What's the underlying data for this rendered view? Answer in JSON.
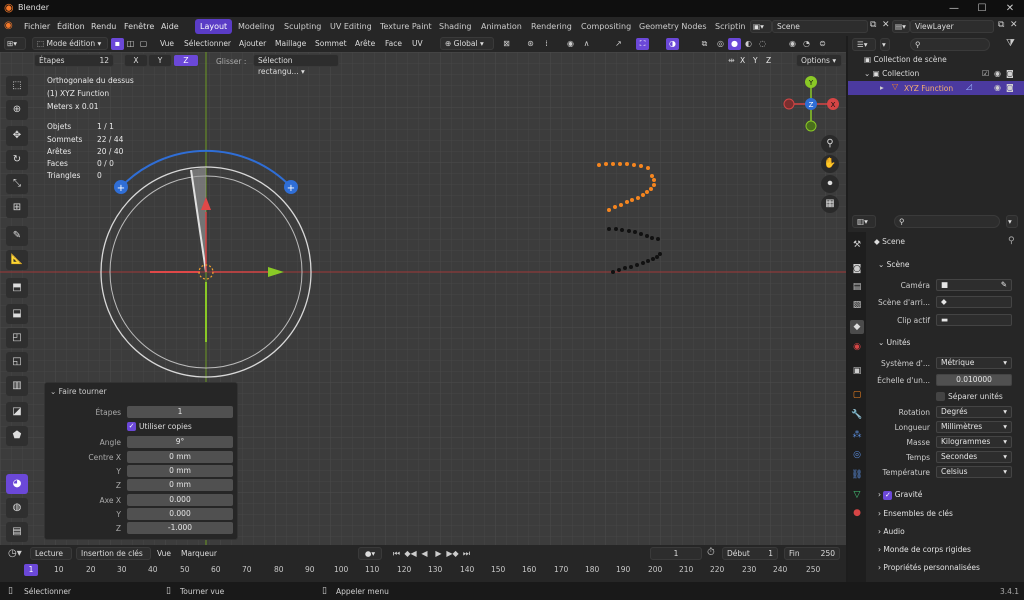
{
  "window": {
    "title": "Blender"
  },
  "menu": {
    "items": [
      "Fichier",
      "Édition",
      "Rendu",
      "Fenêtre",
      "Aide"
    ]
  },
  "workspaces": [
    {
      "label": "Layout",
      "active": true
    },
    {
      "label": "Modeling"
    },
    {
      "label": "Sculpting"
    },
    {
      "label": "UV Editing"
    },
    {
      "label": "Texture Paint"
    },
    {
      "label": "Shading"
    },
    {
      "label": "Animation"
    },
    {
      "label": "Rendering"
    },
    {
      "label": "Compositing"
    },
    {
      "label": "Geometry Nodes"
    },
    {
      "label": "Scriptin"
    }
  ],
  "scene_selector": "Scene",
  "viewlayer_selector": "ViewLayer",
  "viewport_header": {
    "mode": "Mode édition",
    "menus": [
      "Vue",
      "Sélectionner",
      "Ajouter",
      "Maillage",
      "Sommet",
      "Arête",
      "Face",
      "UV"
    ],
    "orientation": "Global"
  },
  "tool_settings": {
    "steps_label": "Étapes",
    "steps_value": "12",
    "axes": [
      "X",
      "Y",
      "Z"
    ],
    "active_axis": "Z",
    "drag_label": "Glisser :",
    "drag_value": "Sélection rectangu...",
    "options": "Options"
  },
  "axis_toggles": [
    "X",
    "Y",
    "Z"
  ],
  "overlay": {
    "view_name": "Orthogonale du dessus",
    "object_name": "(1) XYZ Function",
    "units": "Meters x 0.01",
    "stats": [
      {
        "label": "Objets",
        "value": "1 / 1"
      },
      {
        "label": "Sommets",
        "value": "22 / 44"
      },
      {
        "label": "Arêtes",
        "value": "20 / 40"
      },
      {
        "label": "Faces",
        "value": "0 / 0"
      },
      {
        "label": "Triangles",
        "value": "0"
      }
    ]
  },
  "gizmo": {
    "x": "X",
    "y": "Y",
    "z": "Z"
  },
  "operator_panel": {
    "title": "Faire tourner",
    "steps_label": "Étapes",
    "steps_value": "1",
    "use_copies_label": "Utiliser copies",
    "use_copies": true,
    "angle_label": "Angle",
    "angle_value": "9°",
    "center_x_label": "Centre X",
    "center_x": "0 mm",
    "center_y_label": "Y",
    "center_y": "0 mm",
    "center_z_label": "Z",
    "center_z": "0 mm",
    "axis_x_label": "Axe X",
    "axis_x": "0.000",
    "axis_y_label": "Y",
    "axis_y": "0.000",
    "axis_z_label": "Z",
    "axis_z": "-1.000"
  },
  "timeline": {
    "playback": "Lecture",
    "keying": "Insertion de clés",
    "view": "Vue",
    "marker": "Marqueur",
    "current_frame": "1",
    "start_label": "Début",
    "start": "1",
    "end_label": "Fin",
    "end": "250",
    "ruler": [
      "1",
      "10",
      "20",
      "30",
      "40",
      "50",
      "60",
      "70",
      "80",
      "90",
      "100",
      "110",
      "120",
      "130",
      "140",
      "150",
      "160",
      "170",
      "180",
      "190",
      "200",
      "210",
      "220",
      "230",
      "240",
      "250"
    ]
  },
  "statusbar": {
    "select": "Sélectionner",
    "rotate": "Tourner vue",
    "menu": "Appeler menu",
    "version": "3.4.1"
  },
  "outliner": {
    "scene_collection": "Collection de scène",
    "collection": "Collection",
    "object": "XYZ Function"
  },
  "properties": {
    "breadcrumb": "Scene",
    "scene_section": "Scène",
    "camera_label": "Caméra",
    "background_label": "Scène d'arri...",
    "active_clip_label": "Clip actif",
    "units_section": "Unités",
    "unit_system_label": "Système d'...",
    "unit_system": "Métrique",
    "unit_scale_label": "Échelle d'un...",
    "unit_scale": "0.010000",
    "separate_units_label": "Séparer unités",
    "separate_units": false,
    "rotation_label": "Rotation",
    "rotation": "Degrés",
    "length_label": "Longueur",
    "length": "Millimètres",
    "mass_label": "Masse",
    "mass": "Kilogrammes",
    "time_label": "Temps",
    "time": "Secondes",
    "temperature_label": "Température",
    "temperature": "Celsius",
    "gravity_label": "Gravité",
    "gravity": true,
    "keying_sets": "Ensembles de clés",
    "audio": "Audio",
    "rigid_body_world": "Monde de corps rigides",
    "custom_props": "Propriétés personnalisées"
  },
  "colors": {
    "accent": "#6b48d8",
    "orange": "#f5851f",
    "blue": "#2f6ed6",
    "x_red": "#d64545",
    "y_green": "#8ac926"
  }
}
